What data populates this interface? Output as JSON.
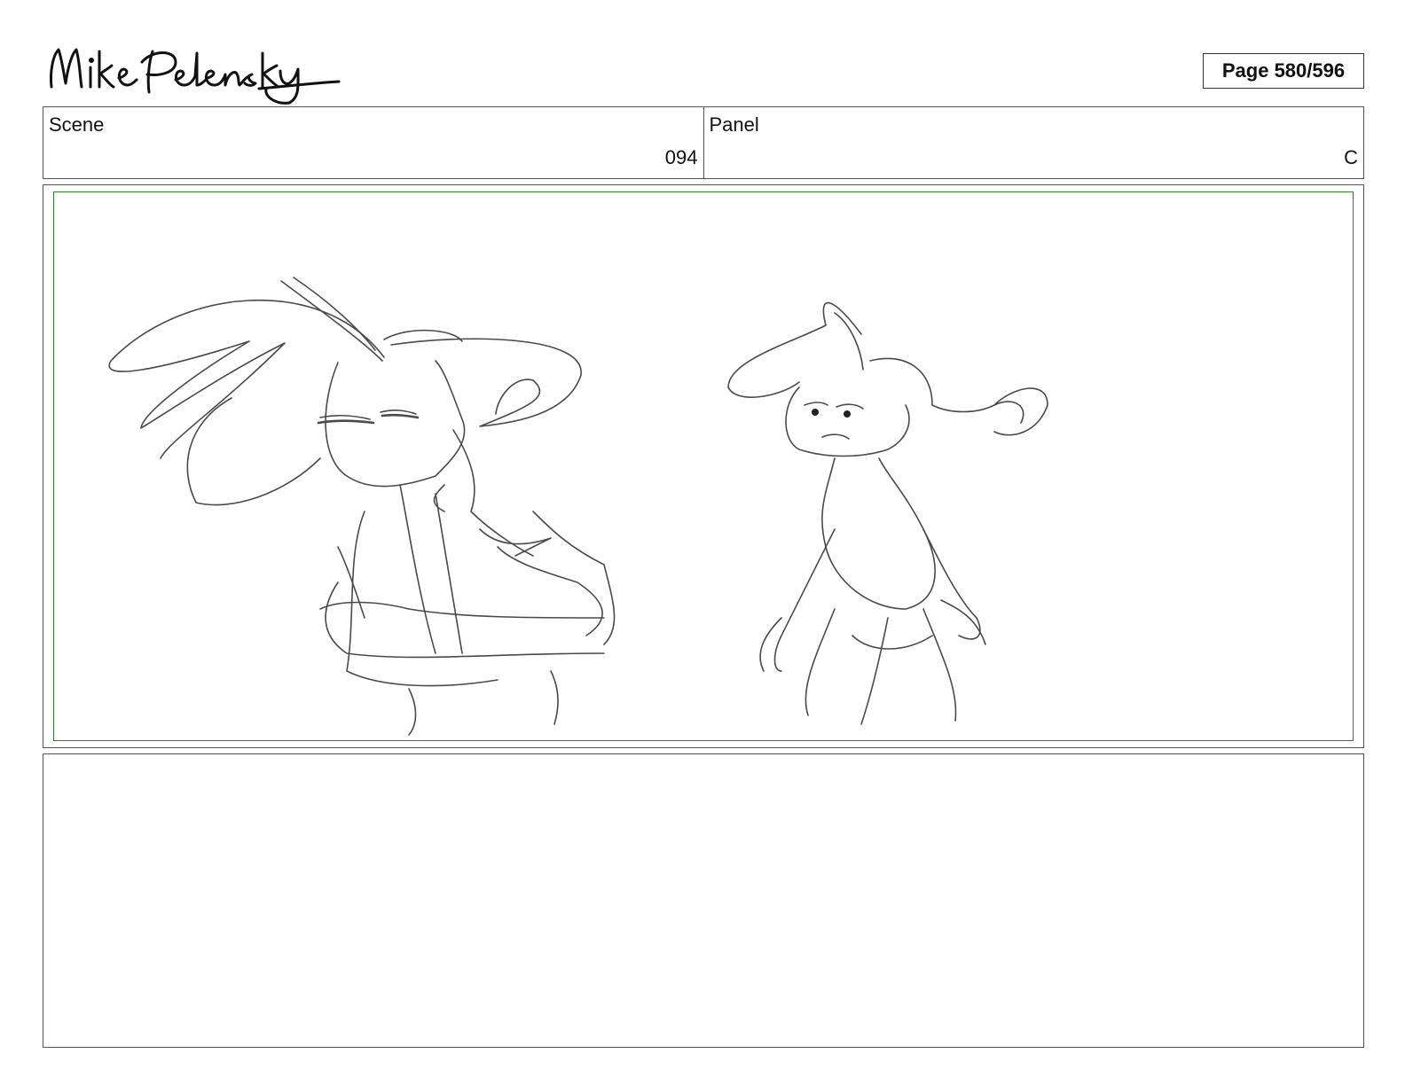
{
  "header": {
    "signature_text": "Mike Pelensky",
    "page_label": "Page 580/596"
  },
  "info": {
    "scene_label": "Scene",
    "scene_value": "094",
    "panel_label": "Panel",
    "panel_value": "C"
  },
  "colors": {
    "frame_border": "#2e7d32",
    "sketch_stroke": "#4a4a4a"
  },
  "icons": {
    "signature": "handwritten-signature-icon",
    "sketch": "storyboard-sketch"
  }
}
